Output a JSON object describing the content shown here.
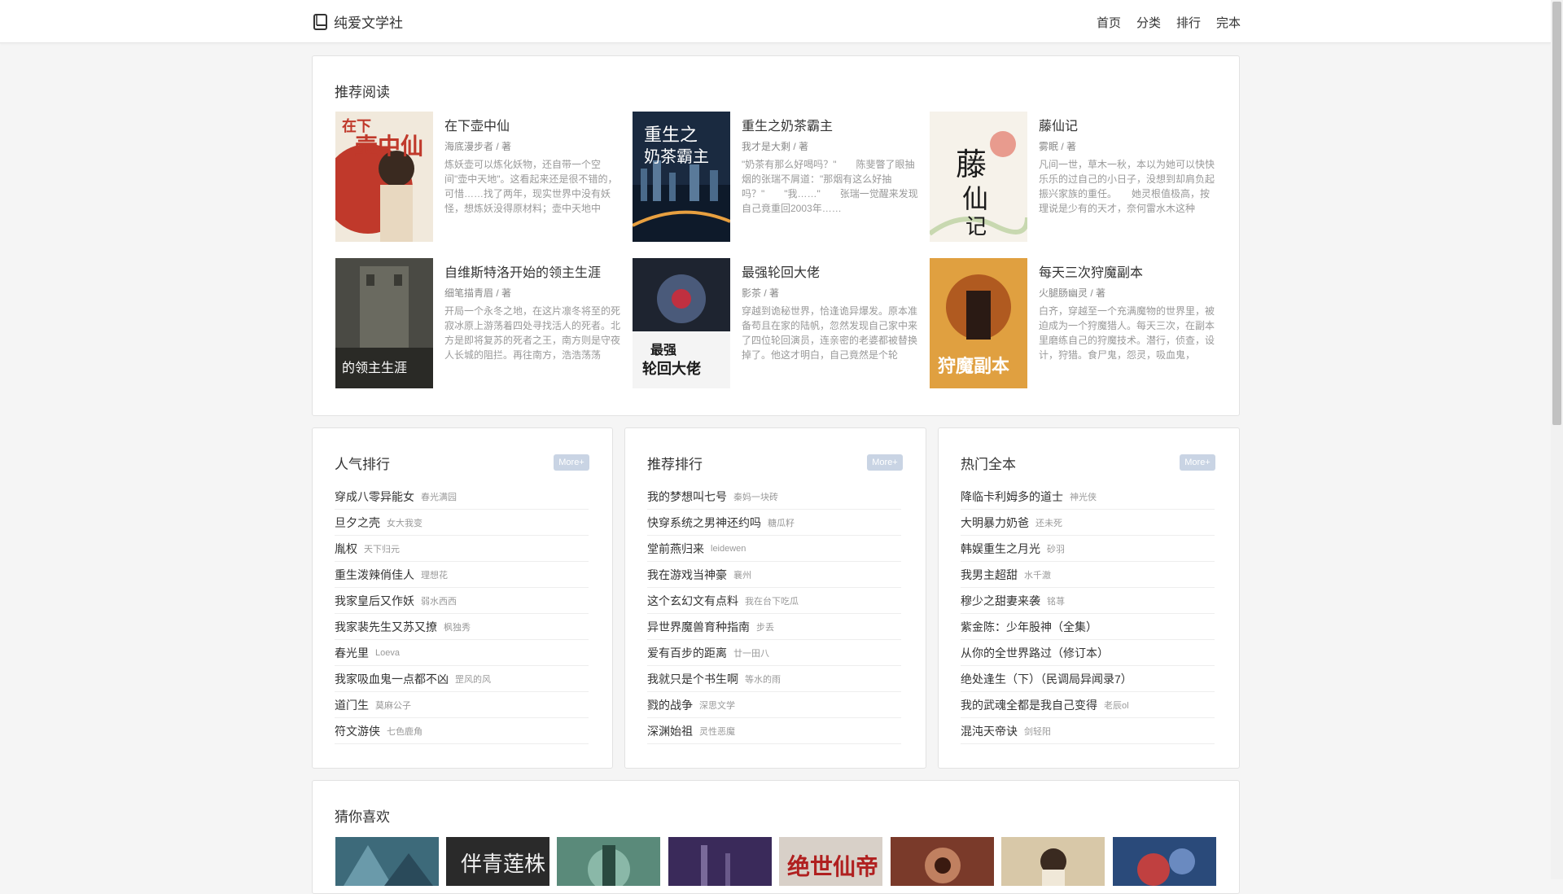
{
  "header": {
    "site_name": "纯爱文学社",
    "nav": [
      "首页",
      "分类",
      "排行",
      "完本"
    ]
  },
  "recommend": {
    "title": "推荐阅读",
    "books": [
      {
        "title": "在下壶中仙",
        "author": "海底漫步者 / 著",
        "desc": "炼妖壶可以炼化妖物，还自带一个空间\"壶中天地\"。这看起来还是很不错的，可惜……找了两年，现实世界中没有妖怪，想炼妖没得原材料；壶中天地中被……",
        "cover_text": "在下壶中仙",
        "cover_color": "#c0392b"
      },
      {
        "title": "重生之奶茶霸主",
        "author": "我才是大剩 / 著",
        "desc": "\"奶茶有那么好喝吗？\"　　陈斐瞥了眼抽烟的张瑞不屑道：\"那烟有这么好抽吗？\"　　\"我……\"　　张瑞一觉醒来发现自己竟重回2003年……",
        "cover_text": "重生之奶茶霸主",
        "cover_color": "#1f3a5a"
      },
      {
        "title": "藤仙记",
        "author": "雾眠 / 著",
        "desc": "凡间一世，草木一秋，本以为她可以快快乐乐的过自己的小日子，没想到却肩负起振兴家族的重任。　　她灵根值极高，按理说是少有的天才，奈何雷水木这种操……",
        "cover_text": "藤仙记",
        "cover_color": "#f3efe6"
      },
      {
        "title": "自维斯特洛开始的领主生涯",
        "author": "细笔描青眉 / 著",
        "desc": "开局一个永冬之地，在这片凛冬将至的死寂冰原上游荡着四处寻找活人的死者。北方是即将复苏的死者之王，南方则是守夜人长城的阻拦。再往南方，浩浩荡荡的……",
        "cover_text": "的领主生涯",
        "cover_color": "#3a3a3a"
      },
      {
        "title": "最强轮回大佬",
        "author": "影茶 / 著",
        "desc": "穿越到诡秘世界，恰逢诡异爆发。原本准备苟且在家的陆帆，忽然发现自己家中来了四位轮回演员，连亲密的老婆都被替换掉了。他这才明白，自己竟然是个轮回……",
        "cover_text": "最强轮回大佬",
        "cover_color": "#2a2f3a"
      },
      {
        "title": "每天三次狩魔副本",
        "author": "火腿肠幽灵 / 著",
        "desc": "白齐，穿越至一个充满魔物的世界里，被迫成为一个狩魔猎人。每天三次，在副本里磨练自己的狩魔技术。潜行，侦查，设计，狩猎。食尸鬼，怨灵，吸血鬼，鱼……",
        "cover_text": "狩魔副本",
        "cover_color": "#d08a2a"
      }
    ]
  },
  "rankings": [
    {
      "title": "人气排行",
      "more": "More+",
      "items": [
        {
          "title": "穿成八零异能女",
          "author": "春光满园"
        },
        {
          "title": "旦夕之壳",
          "author": "女大我变"
        },
        {
          "title": "胤权",
          "author": "天下归元"
        },
        {
          "title": "重生泼辣俏佳人",
          "author": "理想花"
        },
        {
          "title": "我家皇后又作妖",
          "author": "弱水西西"
        },
        {
          "title": "我家裴先生又苏又撩",
          "author": "枫独秀"
        },
        {
          "title": "春光里",
          "author": "Loeva"
        },
        {
          "title": "我家吸血鬼一点都不凶",
          "author": "罡风的风"
        },
        {
          "title": "道门生",
          "author": "莫麻公子"
        },
        {
          "title": "符文游侠",
          "author": "七色鹿角"
        }
      ]
    },
    {
      "title": "推荐排行",
      "more": "More+",
      "items": [
        {
          "title": "我的梦想叫七号",
          "author": "秦妈一块砖"
        },
        {
          "title": "快穿系统之男神还约吗",
          "author": "糖瓜籽"
        },
        {
          "title": "堂前燕归来",
          "author": "leidewen"
        },
        {
          "title": "我在游戏当神豪",
          "author": "襄州"
        },
        {
          "title": "这个玄幻文有点料",
          "author": "我在台下吃瓜"
        },
        {
          "title": "异世界魔兽育种指南",
          "author": "步丢"
        },
        {
          "title": "爱有百步的距离",
          "author": "廿一田八"
        },
        {
          "title": "我就只是个书生啊",
          "author": "等水的雨"
        },
        {
          "title": "戮的战争",
          "author": "深思文学"
        },
        {
          "title": "深渊始祖",
          "author": "灵性恶魔"
        }
      ]
    },
    {
      "title": "热门全本",
      "more": "More+",
      "items": [
        {
          "title": "降临卡利姆多的道士",
          "author": "神光侠"
        },
        {
          "title": "大明暴力奶爸",
          "author": "还未死"
        },
        {
          "title": "韩娱重生之月光",
          "author": "砂羽"
        },
        {
          "title": "我男主超甜",
          "author": "水千澈"
        },
        {
          "title": "穆少之甜妻来袭",
          "author": "铭荨"
        },
        {
          "title": "紫金陈：少年股神（全集）",
          "author": ""
        },
        {
          "title": "从你的全世界路过（修订本）",
          "author": ""
        },
        {
          "title": "绝处逢生（下）（民调局异闻录7）",
          "author": ""
        },
        {
          "title": "我的武魂全都是我自己变得",
          "author": "老辰ol"
        },
        {
          "title": "混沌天帝诀",
          "author": "剑轻阳"
        }
      ]
    }
  ],
  "guess": {
    "title": "猜你喜欢",
    "covers": [
      {
        "text": "",
        "color": "#3d6a7a"
      },
      {
        "text": "伴青莲株",
        "color": "#2a2a2a"
      },
      {
        "text": "",
        "color": "#5a8a7a"
      },
      {
        "text": "",
        "color": "#3a2a5a"
      },
      {
        "text": "绝世仙帝",
        "color": "#d8d0c8"
      },
      {
        "text": "",
        "color": "#7a3a2a"
      },
      {
        "text": "",
        "color": "#d8c8a8"
      },
      {
        "text": "",
        "color": "#2a4a7a"
      }
    ]
  },
  "colors": {
    "accent": "#c9d4e4",
    "panel_bg": "#ffffff",
    "page_bg": "#f5f5f5"
  }
}
